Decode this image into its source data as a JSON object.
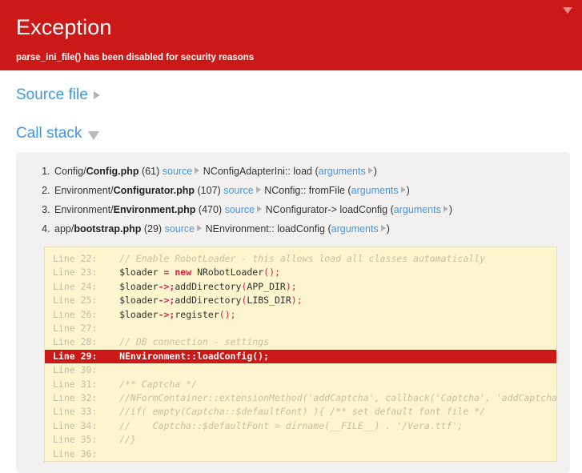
{
  "header": {
    "title": "Exception",
    "message": "parse_ini_file() has been disabled for security reasons",
    "toggle_icon": "triangle-down-icon",
    "bg_color": "#CD1818"
  },
  "sections": {
    "source_file": {
      "label": "Source file",
      "toggle_icon": "triangle-right-icon",
      "expanded": false
    },
    "call_stack": {
      "label": "Call stack",
      "toggle_icon": "triangle-down-icon",
      "expanded": true
    }
  },
  "call_stack": {
    "frames": [
      {
        "index": "1.",
        "dir": "Config/",
        "file": "Config.php",
        "line": "(61)",
        "source_label": "source",
        "callable": "NConfigAdapterIni:: load",
        "open_paren": "(",
        "arguments_label": "arguments",
        "close_paren": ")"
      },
      {
        "index": "2.",
        "dir": "Environment/",
        "file": "Configurator.php",
        "line": "(107)",
        "source_label": "source",
        "callable": "NConfig:: fromFile",
        "open_paren": "(",
        "arguments_label": "arguments",
        "close_paren": ")"
      },
      {
        "index": "3.",
        "dir": "Environment/",
        "file": "Environment.php",
        "line": "(470)",
        "source_label": "source",
        "callable": "NConfigurator-> loadConfig",
        "open_paren": "(",
        "arguments_label": "arguments",
        "close_paren": ")"
      },
      {
        "index": "4.",
        "dir": "app/",
        "file": "bootstrap.php",
        "line": "(29)",
        "source_label": "source",
        "callable": "NEnvironment:: loadConfig",
        "open_paren": "(",
        "arguments_label": "arguments",
        "close_paren": ")"
      }
    ]
  },
  "source_code": {
    "highlight_line": "29",
    "highlight_color": "#CD1818",
    "background_color": "#FDF5CE",
    "lines": [
      {
        "label": "Line 22:",
        "code": "    // Enable RobotLoader - this allows load all classes automatically",
        "style": "comment",
        "active": false
      },
      {
        "label": "Line 23:",
        "code": "    $loader = new NRobotLoader();",
        "style": "code",
        "active": false
      },
      {
        "label": "Line 24:",
        "code": "    $loader->addDirectory(APP_DIR);",
        "style": "code",
        "active": false
      },
      {
        "label": "Line 25:",
        "code": "    $loader->addDirectory(LIBS_DIR);",
        "style": "code",
        "active": false
      },
      {
        "label": "Line 26:",
        "code": "    $loader->register();",
        "style": "code",
        "active": false
      },
      {
        "label": "Line 27:",
        "code": "",
        "style": "code",
        "active": false
      },
      {
        "label": "Line 28:",
        "code": "    // DB connection - settings",
        "style": "comment",
        "active": false
      },
      {
        "label": "Line 29:",
        "code": "    NEnvironment::loadConfig();",
        "style": "code",
        "active": true
      },
      {
        "label": "Line 30:",
        "code": "",
        "style": "code",
        "active": false
      },
      {
        "label": "Line 31:",
        "code": "    /** Captcha */",
        "style": "comment",
        "active": false
      },
      {
        "label": "Line 32:",
        "code": "    //NFormContainer::extensionMethod('addCaptcha', callback('Captcha', 'addCaptcha'));",
        "style": "comment",
        "active": false
      },
      {
        "label": "Line 33:",
        "code": "    //if( empty(Captcha::$defaultFont) ){ /** set default font file */",
        "style": "comment",
        "active": false
      },
      {
        "label": "Line 34:",
        "code": "    //    Captcha::$defaultFont = dirname(__FILE__) . '/Vera.ttf';",
        "style": "comment",
        "active": false
      },
      {
        "label": "Line 35:",
        "code": "    //}",
        "style": "comment",
        "active": false
      },
      {
        "label": "Line 36:",
        "code": "",
        "style": "comment",
        "active": false
      }
    ]
  }
}
